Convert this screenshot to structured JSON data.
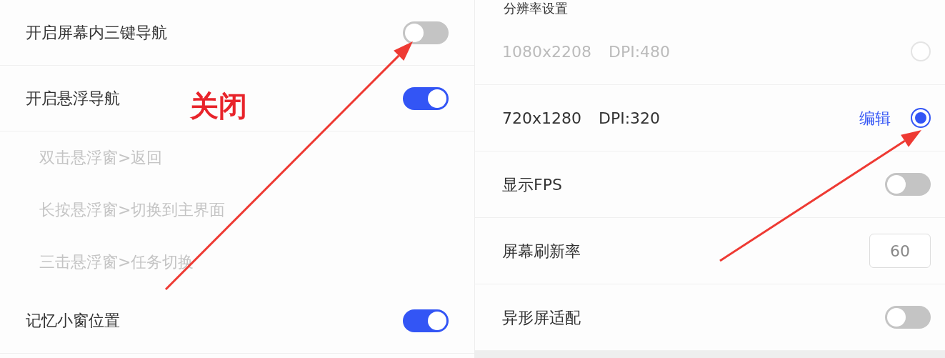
{
  "left_panel": {
    "rows": [
      {
        "kind": "toggle",
        "label": "开启屏幕内三键导航",
        "on": false
      },
      {
        "kind": "toggle",
        "label": "开启悬浮导航",
        "on": true
      },
      {
        "kind": "sub",
        "label": "双击悬浮窗>返回"
      },
      {
        "kind": "sub",
        "label": "长按悬浮窗>切换到主界面"
      },
      {
        "kind": "sub",
        "label": "三击悬浮窗>任务切换"
      },
      {
        "kind": "toggle",
        "label": "记忆小窗位置",
        "on": true
      }
    ]
  },
  "right_panel": {
    "header": "分辨率设置",
    "rows": [
      {
        "kind": "radio",
        "label": "1080x2208",
        "dpi": "DPI:480",
        "selected": false
      },
      {
        "kind": "radio",
        "label": "720x1280",
        "dpi": "DPI:320",
        "selected": true,
        "action": "编辑"
      },
      {
        "kind": "toggle",
        "label": "显示FPS",
        "on": false
      },
      {
        "kind": "number",
        "label": "屏幕刷新率",
        "value": "60"
      },
      {
        "kind": "toggle",
        "label": "异形屏适配",
        "on": false
      }
    ]
  },
  "annotation": {
    "label": "关闭"
  }
}
